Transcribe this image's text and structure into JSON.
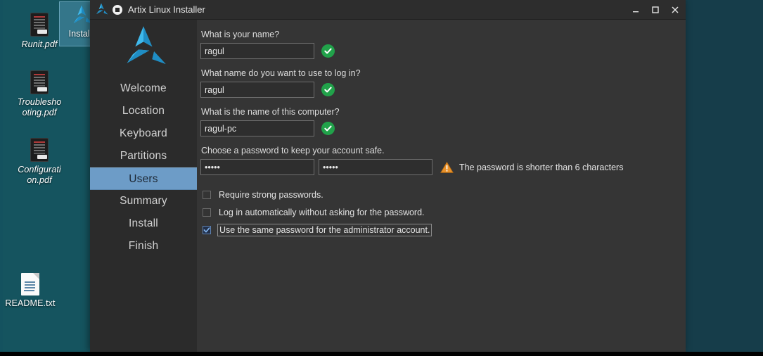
{
  "desktop": {
    "icons": [
      {
        "name": "Runit.pdf",
        "type": "pdf"
      },
      {
        "name": "Troubleshooting.pdf",
        "line1": "Troublesho",
        "line2": "oting.pdf",
        "type": "pdf"
      },
      {
        "name": "Configuration.pdf",
        "line1": "Configurati",
        "line2": "on.pdf",
        "type": "pdf"
      },
      {
        "name": "README.txt",
        "type": "txt"
      }
    ],
    "shortcut": {
      "label": "Install",
      "icon": "artix-logo-icon"
    },
    "background_color": "#14525f"
  },
  "window": {
    "title": "Artix Linux Installer",
    "logo_icon": "artix-logo-icon",
    "badge_icon": "stop-circle-icon",
    "controls": {
      "minimize": {
        "label": "–",
        "icon": "minimize-icon"
      },
      "maximize": {
        "label": "□",
        "icon": "maximize-icon"
      },
      "close": {
        "label": "✕",
        "icon": "close-icon"
      }
    }
  },
  "sidebar": {
    "logo_icon": "artix-logo-icon",
    "items": [
      {
        "label": "Welcome",
        "active": false
      },
      {
        "label": "Location",
        "active": false
      },
      {
        "label": "Keyboard",
        "active": false
      },
      {
        "label": "Partitions",
        "active": false
      },
      {
        "label": "Users",
        "active": true
      },
      {
        "label": "Summary",
        "active": false
      },
      {
        "label": "Install",
        "active": false
      },
      {
        "label": "Finish",
        "active": false
      }
    ],
    "active_color": "#6d9cc7"
  },
  "form": {
    "full_name": {
      "label": "What is your name?",
      "value": "ragul",
      "placeholder": "",
      "status_icon": "check-circle-icon",
      "status_color": "#21a24a"
    },
    "login_name": {
      "label": "What name do you want to use to log in?",
      "value": "ragul",
      "placeholder": "",
      "status_icon": "check-circle-icon",
      "status_color": "#21a24a"
    },
    "hostname": {
      "label": "What is the name of this computer?",
      "value": "ragul-pc",
      "placeholder": "",
      "status_icon": "check-circle-icon",
      "status_color": "#21a24a"
    },
    "password": {
      "label": "Choose a password to keep your account safe.",
      "value": "•••••",
      "confirm_value": "•••••",
      "warning_text": "The password is shorter than 6 characters",
      "warning_icon": "warning-triangle-icon",
      "warning_color": "#e8912a"
    },
    "checkboxes": [
      {
        "label": "Require strong passwords.",
        "checked": false,
        "focused": false
      },
      {
        "label": "Log in automatically without asking for the password.",
        "checked": false,
        "focused": false
      },
      {
        "label": "Use the same password for the administrator account.",
        "checked": true,
        "focused": true
      }
    ]
  }
}
